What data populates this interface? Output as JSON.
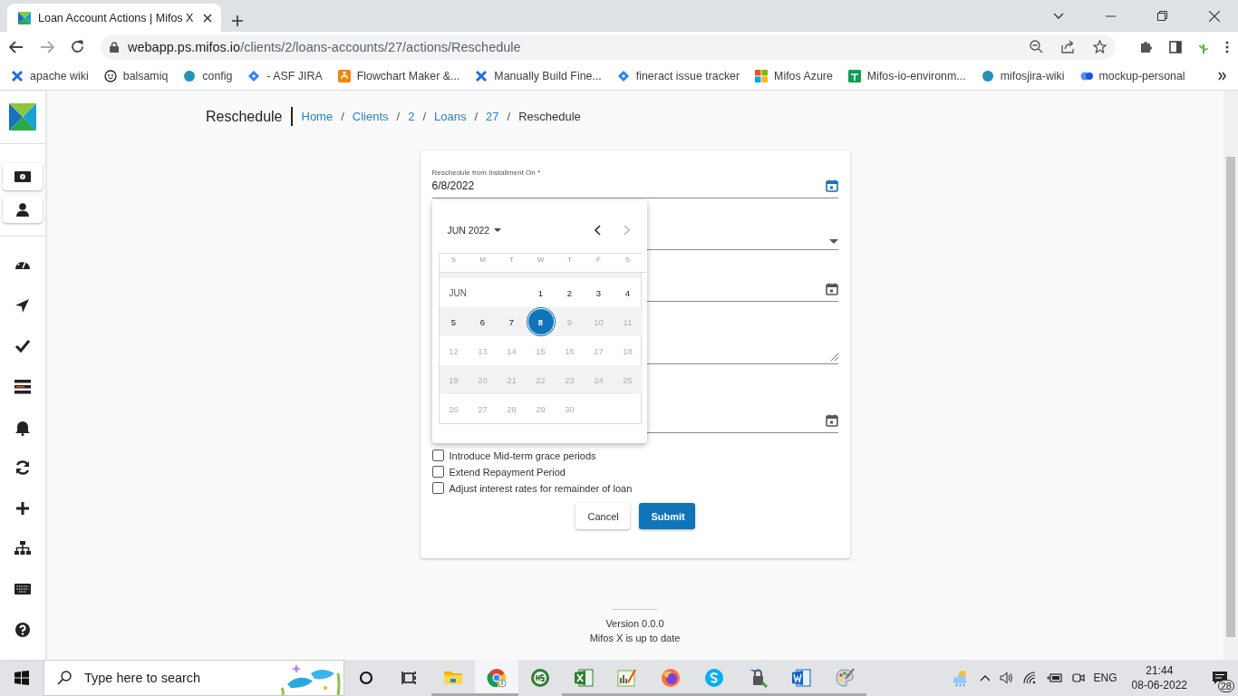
{
  "browser": {
    "tabs": [
      {
        "title": "Loan Account Actions | Mifos X",
        "selected": true
      }
    ],
    "url": {
      "host": "webapp.ps.mifos.io",
      "path": "/clients/2/loans-accounts/27/actions/Reschedule"
    },
    "bookmarks": [
      {
        "label": "apache wiki"
      },
      {
        "label": "balsamiq"
      },
      {
        "label": "config"
      },
      {
        "label": "- ASF JIRA"
      },
      {
        "label": "Flowchart Maker &..."
      },
      {
        "label": "Manually Build Fine..."
      },
      {
        "label": "fineract issue tracker"
      },
      {
        "label": "Mifos Azure"
      },
      {
        "label": "Mifos-io-environm..."
      },
      {
        "label": "mifosjira-wiki"
      },
      {
        "label": "mockup-personal"
      }
    ]
  },
  "page": {
    "title": "Reschedule",
    "breadcrumbs": [
      {
        "label": "Home",
        "kind": "link"
      },
      {
        "label": "/",
        "kind": "separator"
      },
      {
        "label": "Clients",
        "kind": "link"
      },
      {
        "label": "/",
        "kind": "separator"
      },
      {
        "label": "2",
        "kind": "link"
      },
      {
        "label": "/",
        "kind": "separator"
      },
      {
        "label": "Loans",
        "kind": "link"
      },
      {
        "label": "/",
        "kind": "separator"
      },
      {
        "label": "27",
        "kind": "link"
      },
      {
        "label": "/",
        "kind": "separator"
      },
      {
        "label": "Reschedule",
        "kind": "current"
      }
    ],
    "form": {
      "fields": [
        {
          "kind": "date",
          "label": "Reschedule from Installment On *",
          "value": "6/8/2022",
          "focused": true
        },
        {
          "kind": "select"
        },
        {
          "kind": "date",
          "focused": false
        },
        {
          "kind": "textarea"
        },
        {
          "kind": "date",
          "focused": false
        }
      ],
      "checkboxes": [
        {
          "label": "Introduce Mid-term grace periods",
          "checked": false
        },
        {
          "label": "Extend Repayment Period",
          "checked": false
        },
        {
          "label": "Adjust interest rates for remainder of loan",
          "checked": false
        }
      ],
      "buttons": [
        {
          "label": "Cancel",
          "kind": "secondary"
        },
        {
          "label": "Submit",
          "kind": "primary"
        }
      ]
    },
    "datepicker": {
      "period": "JUN 2022",
      "prev_disabled": false,
      "next_disabled": true,
      "month_label": "JUN",
      "weekdays": [
        "S",
        "M",
        "T",
        "W",
        "T",
        "F",
        "S"
      ],
      "days": [
        {
          "label": "1",
          "selected": false,
          "disabled": false
        },
        {
          "label": "2",
          "selected": false,
          "disabled": false
        },
        {
          "label": "3",
          "selected": false,
          "disabled": false
        },
        {
          "label": "4",
          "selected": false,
          "disabled": false
        },
        {
          "label": "5",
          "selected": false,
          "disabled": false
        },
        {
          "label": "6",
          "selected": false,
          "disabled": false
        },
        {
          "label": "7",
          "selected": false,
          "disabled": false
        },
        {
          "label": "8",
          "selected": true,
          "disabled": false
        },
        {
          "label": "9",
          "selected": false,
          "disabled": true
        },
        {
          "label": "10",
          "selected": false,
          "disabled": true
        },
        {
          "label": "11",
          "selected": false,
          "disabled": true
        },
        {
          "label": "12",
          "selected": false,
          "disabled": true
        },
        {
          "label": "13",
          "selected": false,
          "disabled": true
        },
        {
          "label": "14",
          "selected": false,
          "disabled": true
        },
        {
          "label": "15",
          "selected": false,
          "disabled": true
        },
        {
          "label": "16",
          "selected": false,
          "disabled": true
        },
        {
          "label": "17",
          "selected": false,
          "disabled": true
        },
        {
          "label": "18",
          "selected": false,
          "disabled": true
        },
        {
          "label": "19",
          "selected": false,
          "disabled": true
        },
        {
          "label": "20",
          "selected": false,
          "disabled": true
        },
        {
          "label": "21",
          "selected": false,
          "disabled": true
        },
        {
          "label": "22",
          "selected": false,
          "disabled": true
        },
        {
          "label": "23",
          "selected": false,
          "disabled": true
        },
        {
          "label": "24",
          "selected": false,
          "disabled": true
        },
        {
          "label": "25",
          "selected": false,
          "disabled": true
        },
        {
          "label": "26",
          "selected": false,
          "disabled": true
        },
        {
          "label": "27",
          "selected": false,
          "disabled": true
        },
        {
          "label": "28",
          "selected": false,
          "disabled": true
        },
        {
          "label": "29",
          "selected": false,
          "disabled": true
        },
        {
          "label": "30",
          "selected": false,
          "disabled": true
        }
      ]
    },
    "footer": {
      "version": "Version 0.0.0",
      "status": "Mifos X is up to date"
    }
  },
  "taskbar": {
    "search_placeholder": "Type here to search",
    "apps": [
      {
        "running": true,
        "selected": false
      },
      {
        "running": false,
        "selected": true
      },
      {
        "running": false,
        "selected": false
      },
      {
        "running": true,
        "selected": false
      },
      {
        "running": true,
        "selected": false
      },
      {
        "running": true,
        "selected": false
      },
      {
        "running": true,
        "selected": false
      },
      {
        "running": true,
        "selected": false
      },
      {
        "running": true,
        "selected": false
      },
      {
        "running": true,
        "selected": false
      }
    ],
    "language": "ENG",
    "time": "21:44",
    "date": "08-06-2022",
    "notifications": "28"
  }
}
